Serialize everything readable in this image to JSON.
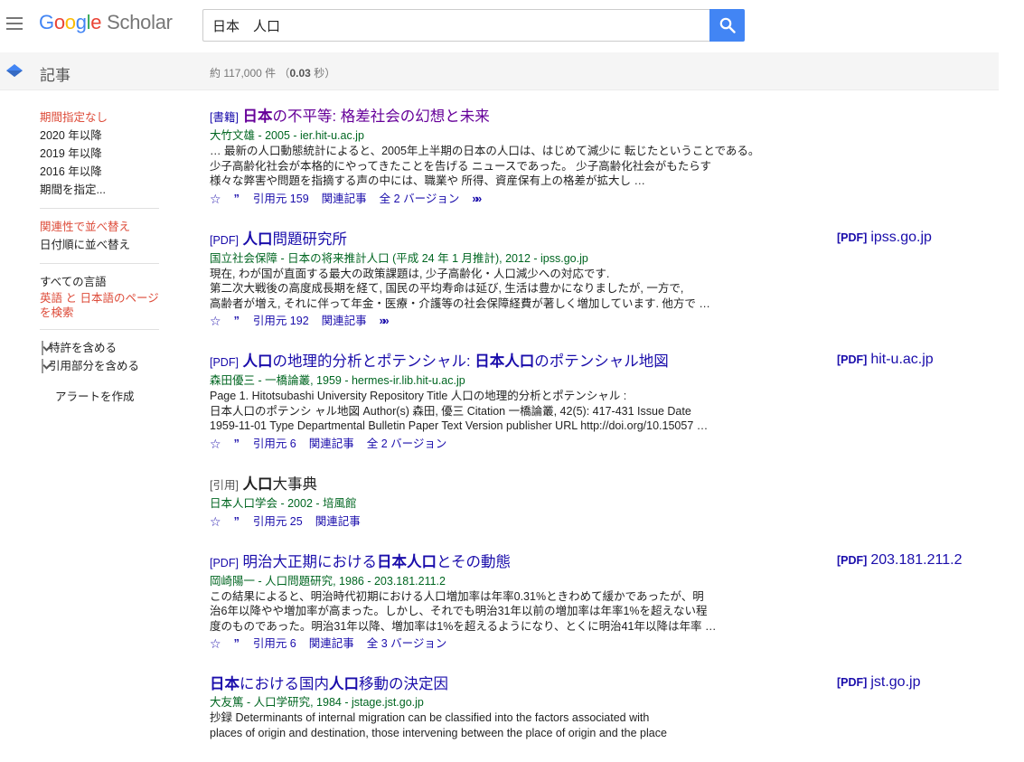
{
  "header": {
    "logo": {
      "g": "G",
      "o1": "o",
      "o2": "o",
      "g2": "g",
      "l": "l",
      "e": "e",
      "scholar": "Scholar"
    },
    "search_value": "日本　人口",
    "search_icon": "search-icon",
    "menu_icon": "hamburger-icon"
  },
  "subbar": {
    "title": "記事",
    "count_prefix": "約 117,000 件 （",
    "count_time": "0.03",
    "count_suffix": " 秒）"
  },
  "sidebar": {
    "time": [
      "期間指定なし",
      "2020 年以降",
      "2019 年以降",
      "2016 年以降",
      "期間を指定..."
    ],
    "sort": [
      "関連性で並べ替え",
      "日付順に並べ替え"
    ],
    "lang": [
      "すべての言語",
      "英語 と 日本語のページを検索"
    ],
    "checks": [
      "特許を含める",
      "引用部分を含める"
    ],
    "alert": "アラートを作成"
  },
  "results": [
    {
      "tag": "[書籍]",
      "title": [
        "日本",
        "の不平等: 格差社会の幻想と未来"
      ],
      "meta": "大竹文雄 - 2005 - ier.hit-u.ac.jp",
      "snippet": [
        "… 最新の人口動態統計によると、2005年上半期の日本の人口は、はじめて減少に 転じたということである。",
        "少子高齢化社会が本格的にやってきたことを告げる ニュースであった。 少子高齢化社会がもたらす",
        "様々な弊害や問題を指摘する声の中には、職業や 所得、資産保有上の格差が拡大し …"
      ],
      "links": [
        "引用元 159",
        "関連記事",
        "全 2 バージョン"
      ]
    },
    {
      "tag": "[PDF]",
      "title": [
        "人口",
        "問題研究所"
      ],
      "meta": "国立社会保障 - 日本の将来推計人口 (平成 24 年 1 月推計), 2012 - ipss.go.jp",
      "snippet": [
        "現在, わが国が直面する最大の政策課題は, 少子高齢化・人口減少への対応です.",
        "第二次大戦後の高度成長期を経て, 国民の平均寿命は延び, 生活は豊かになりましたが, 一方で,",
        "高齢者が増え, それに伴って年金・医療・介護等の社会保障経費が著しく増加しています. 他方で …"
      ],
      "links": [
        "引用元 192",
        "関連記事"
      ],
      "side": {
        "pdf": "[PDF]",
        "host": "ipss.go.jp"
      }
    },
    {
      "tag": "[PDF]",
      "title": [
        "人口",
        "の地理的分析とポテンシャル: ",
        "日本人口",
        "のポテンシャル地図"
      ],
      "meta": "森田優三 - 一橋論叢, 1959 - hermes-ir.lib.hit-u.ac.jp",
      "snippet": [
        "Page 1. Hitotsubashi University Repository Title 人口の地理的分析とポテンシャル :",
        "日本人口のポテンシ ャル地図 Author(s) 森田, 優三 Citation 一橋論叢, 42(5): 417-431 Issue Date",
        "1959-11-01 Type Departmental Bulletin Paper Text Version publisher URL http://doi.org/10.15057 …"
      ],
      "links": [
        "引用元 6",
        "関連記事",
        "全 2 バージョン"
      ],
      "side": {
        "pdf": "[PDF]",
        "host": "hit-u.ac.jp"
      }
    },
    {
      "tag": "[引用]",
      "title": [
        "人口",
        "大事典"
      ],
      "meta": "日本人口学会 - 2002 - 培風館",
      "links": [
        "引用元 25",
        "関連記事"
      ]
    },
    {
      "tag": "[PDF]",
      "title": [
        "明治大正期における",
        "日本人口",
        "とその動態"
      ],
      "meta": "岡崎陽一 - 人口問題研究, 1986 - 203.181.211.2",
      "snippet": [
        "この結果によると、明治時代初期における人口増加率は年率0.31%ときわめて緩かであったが、明",
        "治6年以降やや増加率が高まった。しかし、それでも明治31年以前の増加率は年率1%を超えない程",
        "度のものであった。明治31年以降、増加率は1%を超えるようになり、とくに明治41年以降は年率 …"
      ],
      "links": [
        "引用元 6",
        "関連記事",
        "全 3 バージョン"
      ],
      "side": {
        "pdf": "[PDF]",
        "host": "203.181.211.2"
      }
    },
    {
      "title": [
        "日本",
        "における国内",
        "人口",
        "移動の決定因"
      ],
      "meta": "大友篤 - 人口学研究, 1984 - jstage.jst.go.jp",
      "snippet": [
        "抄録 Determinants of internal migration can be classified into the factors associated with",
        "places of origin and destination, those intervening between the place of origin and the place"
      ],
      "side": {
        "pdf": "[PDF]",
        "host": "jst.go.jp"
      }
    }
  ]
}
